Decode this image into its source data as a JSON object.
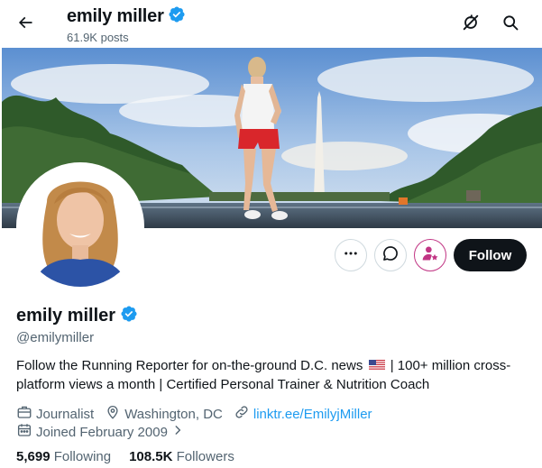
{
  "header": {
    "name": "emily miller",
    "posts": "61.9K posts"
  },
  "profile": {
    "name": "emily miller",
    "handle": "@emilymiller",
    "bio_before_flag": "Follow the Running Reporter for on-the-ground D.C. news ",
    "bio_after_flag": " | 100+ million cross-platform views a month | Certified Personal Trainer & Nutrition Coach",
    "occupation": "Journalist",
    "location": "Washington, DC",
    "link": "linktr.ee/EmilyjMiller",
    "joined": "Joined February 2009",
    "following_count": "5,699",
    "following_label": "Following",
    "followers_count": "108.5K",
    "followers_label": "Followers"
  },
  "actions": {
    "follow_label": "Follow"
  },
  "colors": {
    "verified": "#1d9bf0",
    "link": "#1d9bf0",
    "muted": "#536471",
    "subscribe_accent": "#c13584",
    "follow_bg": "#0f1419"
  },
  "icons": [
    "back-arrow-icon",
    "verified-badge-icon",
    "notification-off-icon",
    "search-icon",
    "more-icon",
    "message-icon",
    "subscribe-icon",
    "briefcase-icon",
    "location-pin-icon",
    "link-icon",
    "calendar-icon",
    "chevron-right-icon",
    "us-flag-icon"
  ]
}
